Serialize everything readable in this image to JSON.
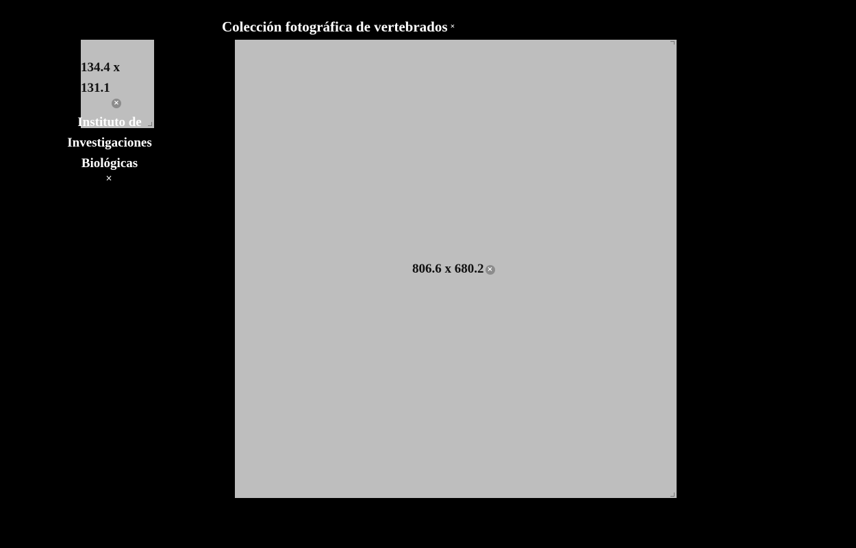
{
  "header": {
    "title": "Colección fotográfica de vertebrados",
    "close_glyph": "×"
  },
  "thumbnail": {
    "dimensions_line1": "134.4 x",
    "dimensions_line2": "131.1",
    "remove_glyph": "×",
    "background_color": "#bebebe"
  },
  "institute": {
    "line1": "Instituto de",
    "line2": "Investigaciones",
    "line3": "Biológicas",
    "close_glyph": "×"
  },
  "main_image": {
    "dimensions": "806.6 x 680.2",
    "remove_glyph": "×",
    "background_color": "#bebebe"
  },
  "colors": {
    "page_background": "#000000",
    "placeholder": "#bebebe",
    "remove_button": "#8c8c8c",
    "text_light": "#ffffff"
  }
}
